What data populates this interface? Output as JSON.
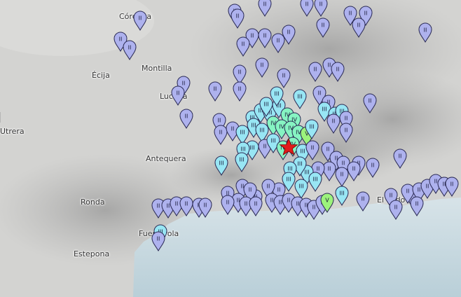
{
  "map": {
    "cities": [
      {
        "id": "cordoba",
        "label": "Córdoba"
      },
      {
        "id": "ecija",
        "label": "Écija"
      },
      {
        "id": "montilla",
        "label": "Montilla"
      },
      {
        "id": "lucena",
        "label": "Lucena"
      },
      {
        "id": "utrera",
        "label": "Utrera"
      },
      {
        "id": "antequera",
        "label": "Antequera"
      },
      {
        "id": "ronda",
        "label": "Ronda"
      },
      {
        "id": "fuengirola",
        "label": "Fuengirola"
      },
      {
        "id": "estepona",
        "label": "Estepona"
      },
      {
        "id": "el-ejido",
        "label": "El Ejido"
      }
    ],
    "epicenter": {
      "label": "★",
      "color": "#e01b1b"
    },
    "intensity_colors": {
      "II": "#aeb2ee",
      "III": "#98e6f4",
      "IV": "#86f4c2",
      "V": "#9cf27c"
    }
  }
}
